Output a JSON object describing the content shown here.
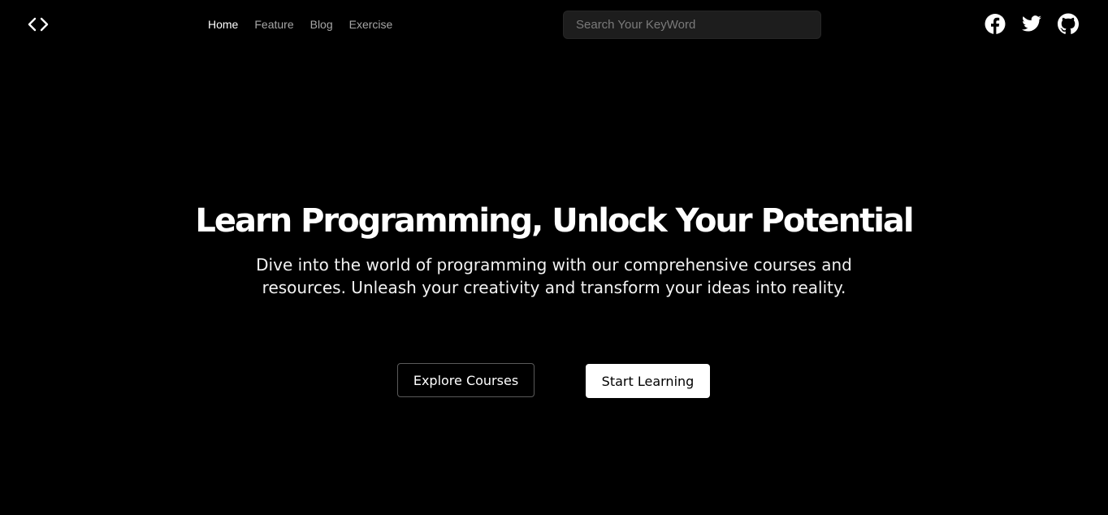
{
  "header": {
    "logo_icon": "code-brackets-icon",
    "nav": [
      {
        "label": "Home",
        "active": true
      },
      {
        "label": "Feature",
        "active": false
      },
      {
        "label": "Blog",
        "active": false
      },
      {
        "label": "Exercise",
        "active": false
      }
    ],
    "search": {
      "placeholder": "Search Your KeyWord",
      "value": ""
    },
    "social_icons": [
      "facebook-icon",
      "twitter-icon",
      "github-icon"
    ]
  },
  "hero": {
    "title": "Learn Programming, Unlock Your Potential",
    "subtitle": "Dive into the world of programming with our comprehensive courses and resources. Unleash your creativity and transform your ideas into reality.",
    "primary_button": "Explore Courses",
    "secondary_button": "Start Learning"
  },
  "colors": {
    "background": "#000000",
    "text": "#ffffff",
    "nav_inactive": "#a6a6a6",
    "search_bg": "#1d1d1d"
  }
}
